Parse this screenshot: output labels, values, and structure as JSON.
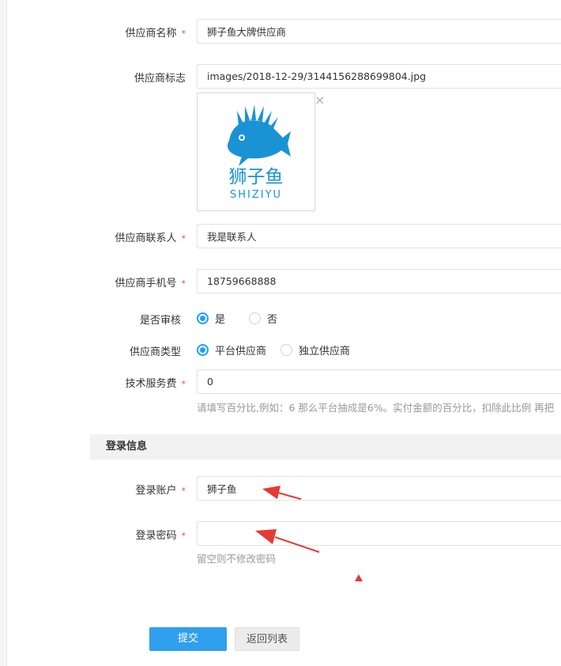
{
  "form": {
    "supplier_name": {
      "label": "供应商名称",
      "value": "狮子鱼大牌供应商"
    },
    "supplier_logo": {
      "label": "供应商标志",
      "value": "images/2018-12-29/3144156288699804.jpg",
      "close_glyph": "×",
      "logo_text_cn": "狮子鱼",
      "logo_text_en": "SHIZIYU"
    },
    "contact": {
      "label": "供应商联系人",
      "value": "我是联系人"
    },
    "phone": {
      "label": "供应商手机号",
      "value": "18759668888"
    },
    "audit": {
      "label": "是否审核",
      "options": [
        "是",
        "否"
      ],
      "selected": "是"
    },
    "type": {
      "label": "供应商类型",
      "options": [
        "平台供应商",
        "独立供应商"
      ],
      "selected": "平台供应商"
    },
    "fee": {
      "label": "技术服务费",
      "value": "0",
      "hint": "请填写百分比,例如：6 那么平台抽成是6%。实付金额的百分比，扣除此比例 再把"
    },
    "required_mark": "*"
  },
  "login": {
    "section_title": "登录信息",
    "account": {
      "label": "登录账户",
      "value": "狮子鱼"
    },
    "password": {
      "label": "登录密码",
      "value": "",
      "hint": "留空则不修改密码"
    }
  },
  "buttons": {
    "submit": "提交",
    "back": "返回列表"
  },
  "colors": {
    "accent": "#1e9fff",
    "primary_button": "#2f9ff0",
    "required": "#e84a4a",
    "annotation_arrow": "#e53935"
  }
}
